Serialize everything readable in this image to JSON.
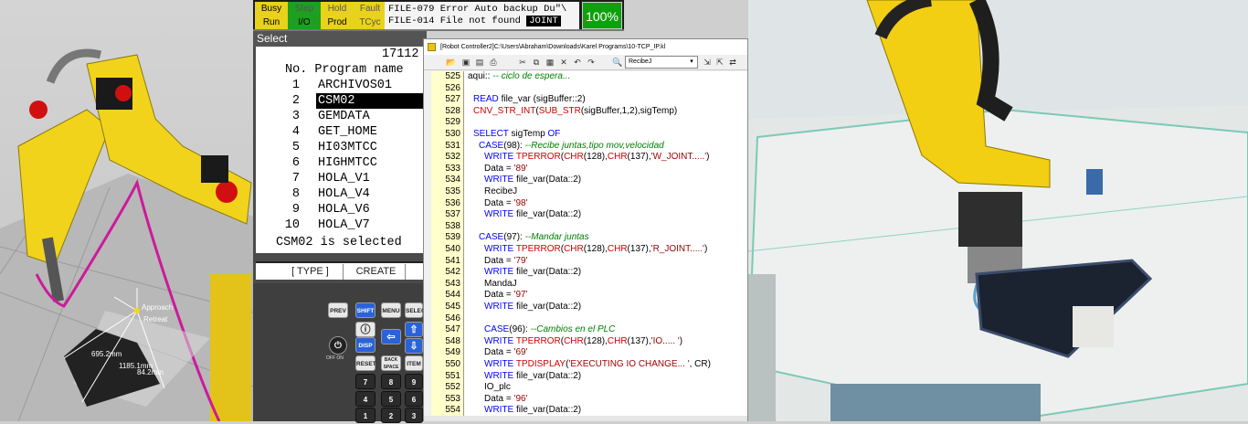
{
  "scene": {
    "labels": [
      "Approach",
      "Retreat",
      "695.2mm",
      "1185.1mm",
      "84.2mm"
    ]
  },
  "pendant": {
    "status_buttons": [
      "Busy",
      "Step",
      "Hold",
      "Fault",
      "Run",
      "I/O",
      "Prod",
      "TCyc"
    ],
    "alarm_line1": "FILE-079 Error Auto backup Du\"\\",
    "alarm_line2": "FILE-014 File not found",
    "alarm_badge": "JOINT",
    "override_pct": "100%",
    "screen_title": "Select",
    "memory_count": "17112",
    "header": "No.  Program name",
    "programs": [
      {
        "num": "1",
        "name": "ARCHIVOS01"
      },
      {
        "num": "2",
        "name": "CSM02"
      },
      {
        "num": "3",
        "name": "GEMDATA"
      },
      {
        "num": "4",
        "name": "GET_HOME"
      },
      {
        "num": "5",
        "name": "HI03MTCC"
      },
      {
        "num": "6",
        "name": "HIGHMTCC"
      },
      {
        "num": "7",
        "name": "HOLA_V1"
      },
      {
        "num": "8",
        "name": "HOLA_V4"
      },
      {
        "num": "9",
        "name": "HOLA_V6"
      },
      {
        "num": "10",
        "name": "HOLA_V7"
      }
    ],
    "selected_program": "CSM02",
    "selected_message": "CSM02 is selected",
    "fkeys": [
      "[ TYPE ]",
      "CREATE"
    ],
    "keys": {
      "prev": "PREV",
      "shift": "SHIFT",
      "menu": "MENU",
      "select": "SELECT",
      "disp": "DISP",
      "reset": "RESET",
      "backspace": "BACK SPACE",
      "item": "ITEM",
      "off_on": "OFF ON",
      "digits": [
        "7",
        "8",
        "9",
        "4",
        "5",
        "6",
        "1",
        "2",
        "3"
      ]
    }
  },
  "editor": {
    "title": "[Robot Controller2]C:\\Users\\Abraham\\Downloads\\Karel Programs\\10-TCP_IP.kl",
    "search_value": "RecibeJ",
    "lines": [
      {
        "n": "525",
        "html": "aqui::             <span class='cm'>-- ciclo de espera...</span>",
        "indent": 0
      },
      {
        "n": "526",
        "html": "",
        "indent": 0
      },
      {
        "n": "527",
        "html": "<span class='kw'>READ</span> file_var (sigBuffer::2)",
        "indent": 1
      },
      {
        "n": "528",
        "html": "<span class='fn'>CNV_STR_INT</span>(<span class='fn'>SUB_STR</span>(sigBuffer,1,2),sigTemp)",
        "indent": 1
      },
      {
        "n": "529",
        "html": "",
        "indent": 0
      },
      {
        "n": "530",
        "html": "<span class='kw'>SELECT</span> sigTemp <span class='kw'>OF</span>",
        "indent": 1
      },
      {
        "n": "531",
        "html": "<span class='kw'>CASE</span>(98):  <span class='cm'>--Recibe juntas,tipo mov,velocidad</span>",
        "indent": 2
      },
      {
        "n": "532",
        "html": "<span class='kw'>WRITE</span> <span class='fn'>TPERROR</span>(<span class='fn'>CHR</span>(128),<span class='fn'>CHR</span>(137),<span class='str'>'W_JOINT.....'</span>)",
        "indent": 3
      },
      {
        "n": "533",
        "html": "Data = <span class='str'>'89'</span>",
        "indent": 3
      },
      {
        "n": "534",
        "html": "<span class='kw'>WRITE</span> file_var(Data::2)",
        "indent": 3
      },
      {
        "n": "535",
        "html": "RecibeJ",
        "indent": 3
      },
      {
        "n": "536",
        "html": "Data = <span class='str'>'98'</span>",
        "indent": 3
      },
      {
        "n": "537",
        "html": "<span class='kw'>WRITE</span> file_var(Data::2)",
        "indent": 3
      },
      {
        "n": "538",
        "html": "",
        "indent": 0
      },
      {
        "n": "539",
        "html": "<span class='kw'>CASE</span>(97):  <span class='cm'>--Mandar juntas</span>",
        "indent": 2
      },
      {
        "n": "540",
        "html": "<span class='kw'>WRITE</span> <span class='fn'>TPERROR</span>(<span class='fn'>CHR</span>(128),<span class='fn'>CHR</span>(137),<span class='str'>'R_JOINT.....'</span>)",
        "indent": 3
      },
      {
        "n": "541",
        "html": "Data = <span class='str'>'79'</span>",
        "indent": 3
      },
      {
        "n": "542",
        "html": "<span class='kw'>WRITE</span> file_var(Data::2)",
        "indent": 3
      },
      {
        "n": "543",
        "html": "MandaJ",
        "indent": 3
      },
      {
        "n": "544",
        "html": "Data = <span class='str'>'97'</span>",
        "indent": 3
      },
      {
        "n": "545",
        "html": "<span class='kw'>WRITE</span> file_var(Data::2)",
        "indent": 3
      },
      {
        "n": "546",
        "html": "",
        "indent": 0
      },
      {
        "n": "547",
        "html": "<span class='kw'>CASE</span>(96):  <span class='cm'>--Cambios en el PLC</span>",
        "indent": 3
      },
      {
        "n": "548",
        "html": "<span class='kw'>WRITE</span> <span class='fn'>TPERROR</span>(<span class='fn'>CHR</span>(128),<span class='fn'>CHR</span>(137),<span class='str'>'IO..... '</span>)",
        "indent": 3
      },
      {
        "n": "549",
        "html": "Data = <span class='str'>'69'</span>",
        "indent": 3
      },
      {
        "n": "550",
        "html": "<span class='kw'>WRITE</span> <span class='fn'>TPDISPLAY</span>(<span class='str'>'EXECUTING IO CHANGE... '</span>, CR)",
        "indent": 3
      },
      {
        "n": "551",
        "html": "<span class='kw'>WRITE</span> file_var(Data::2)",
        "indent": 3
      },
      {
        "n": "552",
        "html": "IO_plc",
        "indent": 3
      },
      {
        "n": "553",
        "html": "Data = <span class='str'>'96'</span>",
        "indent": 3
      },
      {
        "n": "554",
        "html": "<span class='kw'>WRITE</span> file_var(Data::2)",
        "indent": 3
      }
    ]
  },
  "colors": {
    "robot_yellow": "#f2d31b",
    "alarm_green": "#0ea10e",
    "gutter_yellow": "#ffffcc"
  }
}
